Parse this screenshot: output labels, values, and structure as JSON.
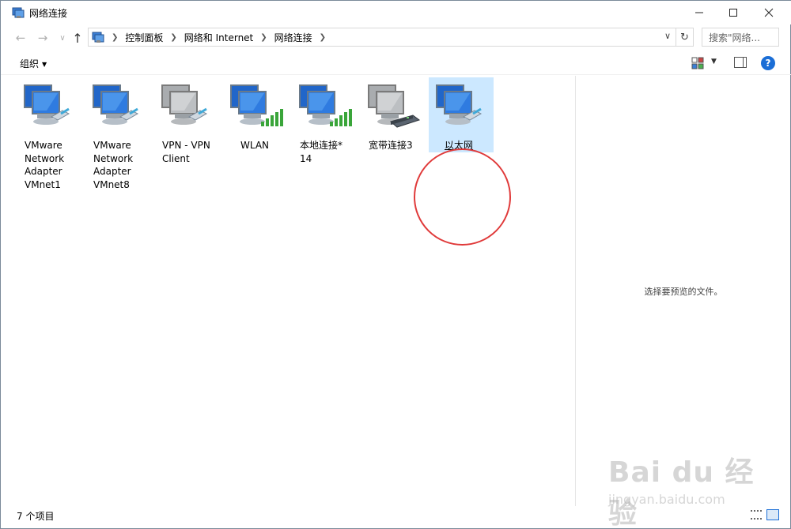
{
  "window": {
    "title": "网络连接",
    "icon": "network-connections-icon"
  },
  "address_bar": {
    "breadcrumbs": [
      "控制面板",
      "网络和 Internet",
      "网络连接"
    ],
    "search_placeholder": "搜索\"网络..."
  },
  "toolbar": {
    "organize_label": "组织"
  },
  "items": [
    {
      "label_lines": [
        "VMware",
        "Network",
        "Adapter",
        "VMnet1"
      ],
      "icon": "network-adapter-icon",
      "state": "enabled",
      "selected": false
    },
    {
      "label_lines": [
        "VMware",
        "Network",
        "Adapter",
        "VMnet8"
      ],
      "icon": "network-adapter-icon",
      "state": "enabled",
      "selected": false
    },
    {
      "label_lines": [
        "VPN - VPN",
        "Client"
      ],
      "icon": "vpn-adapter-icon",
      "state": "disabled",
      "selected": false
    },
    {
      "label_lines": [
        "WLAN"
      ],
      "icon": "wifi-adapter-icon",
      "state": "enabled",
      "selected": false
    },
    {
      "label_lines": [
        "本地连接*",
        "14"
      ],
      "icon": "wifi-adapter-icon",
      "state": "enabled",
      "selected": false
    },
    {
      "label_lines": [
        "宽带连接3"
      ],
      "icon": "broadband-adapter-icon",
      "state": "disabled",
      "selected": false
    },
    {
      "label_lines": [
        "以太网"
      ],
      "icon": "ethernet-adapter-icon",
      "state": "enabled",
      "selected": true
    }
  ],
  "preview": {
    "message": "选择要预览的文件。"
  },
  "status_bar": {
    "item_count": "7 个项目"
  },
  "watermark": {
    "main": "Bai du 经验",
    "sub": "jingyan.baidu.com"
  },
  "colors": {
    "selection": "#cce8ff",
    "annotation_circle": "#e03a3a",
    "accent": "#1b6ed6"
  }
}
